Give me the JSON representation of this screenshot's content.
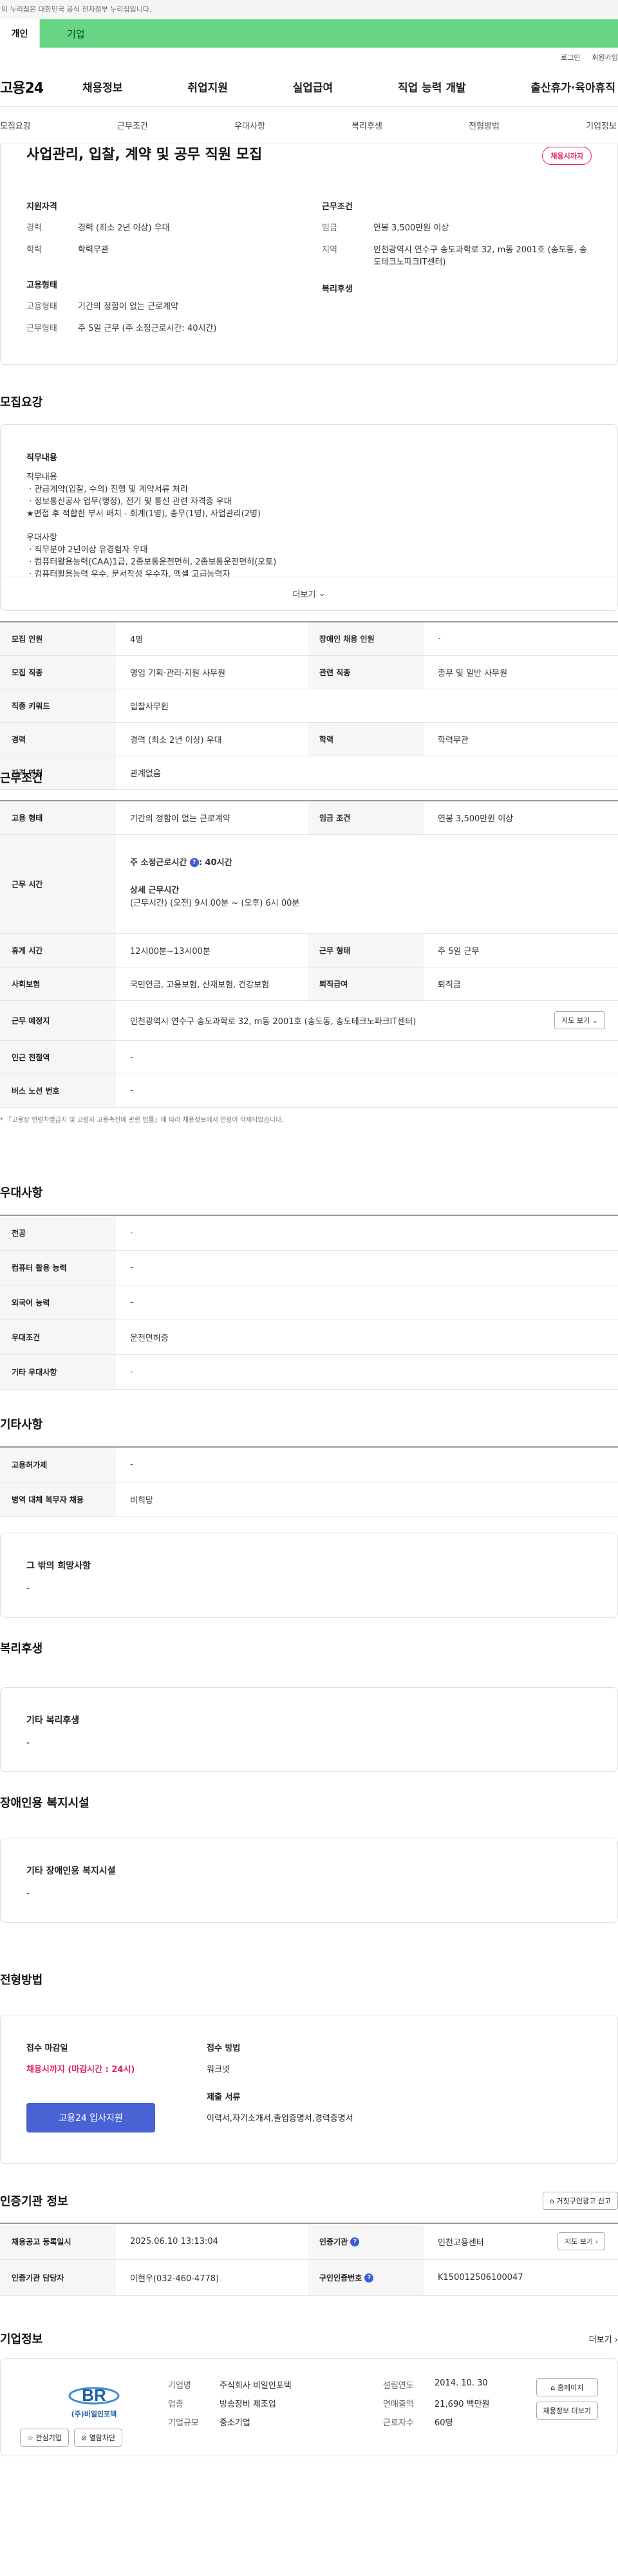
{
  "gov_banner": "이 누리집은 대한민국 공식 전자정부 누리집입니다.",
  "tabs": {
    "individual": "개인",
    "corporate": "기업"
  },
  "util": {
    "login": "로그인",
    "signup": "회원가입"
  },
  "logo": "고용24",
  "gnb": [
    "채용정보",
    "취업지원",
    "실업급여",
    "직업 능력 개발",
    "출산휴가·육아휴직"
  ],
  "subnav": [
    "모집요강",
    "근무조건",
    "우대사항",
    "복리후생",
    "전형방법",
    "기업정보"
  ],
  "summary": {
    "title": "사업관리, 입찰, 계약 및 공무 직원 모집",
    "badge": "채용시까지",
    "qual_h": "지원자격",
    "career_k": "경력",
    "career_v": "경력 (최소 2년 이상) 우대",
    "edu_k": "학력",
    "edu_v": "학력무관",
    "emp_h": "고용형태",
    "emptype_k": "고용형태",
    "emptype_v": "기간의 정함이 없는 근로계약",
    "workform_k": "근무형태",
    "workform_v": "주 5일 근무 (주 소정근로시간: 40시간)",
    "cond_h": "근무조건",
    "wage_k": "임금",
    "wage_v": "연봉 3,500만원 이상",
    "loc_k": "지역",
    "loc_v": "인천광역시 연수구 송도과학로 32, m동 2001호 (송도동, 송도테크노파크IT센터)",
    "welfare_h": "복리후생"
  },
  "recruit": {
    "title": "모집요강",
    "content_h": "직무내용",
    "content": "직무내용\n · 관급계약(입찰, 수의) 진행 및 계약서류 처리\n · 정보통신공사 업무(행정), 전기 및 통신 관련 자격증 우대\n★면접 후 적합한 부서 배치 - 회계(1명), 총무(1명), 사업관리(2명)\n\n우대사항\n · 직무분야 2년이상 유경험자 우대\n · 컴퓨터활용능력(CAA)1급, 2종보통운전면허, 2종보통운전면허(오토)\n · 컴퓨터활용능력 우수, 문서작성 우수자, 엑셀 고급능력자",
    "more": "더보기",
    "table": {
      "count_k": "모집 인원",
      "count_v": "4명",
      "disabled_k": "장애인 채용 인원",
      "disabled_v": "-",
      "job_k": "모집 직종",
      "job_v": "영업 기획·관리·지원 사무원",
      "rel_k": "관련 직종",
      "rel_v": "총무 및 일반 사무원",
      "kw_k": "직종 키워드",
      "kw_v": "입찰사무원",
      "career_k": "경력",
      "career_v": "경력 (최소 2년 이상) 우대",
      "edu_k": "학력",
      "edu_v": "학력무관",
      "license_k": "자격 면허",
      "license_v": "관계없음"
    }
  },
  "conditions": {
    "title": "근무조건",
    "emp_k": "고용 형태",
    "emp_v": "기간의 정함이 없는 근로계약",
    "wage_k": "임금 조건",
    "wage_v": "연봉 3,500만원 이상",
    "time_k": "근무 시간",
    "time_weekly": "주 소정근로시간",
    "time_weekly_v": ": 40시간",
    "time_detail_h": "상세 근무시간",
    "time_detail_v": "(근무시간) (오전) 9시 00분 ~ (오후) 6시 00분",
    "rest_k": "휴게 시간",
    "rest_v": "12시00분~13시00분",
    "form_k": "근무 형태",
    "form_v": "주 5일 근무",
    "ins_k": "사회보험",
    "ins_v": "국민연금, 고용보험, 산재보험, 건강보험",
    "sev_k": "퇴직급여",
    "sev_v": "퇴직금",
    "place_k": "근무 예정지",
    "place_v": "인천광역시 연수구 송도과학로 32, m동 2001호 (송도동, 송도테크노파크IT센터)",
    "map_btn": "지도 보기",
    "subway_k": "인근 전철역",
    "subway_v": "-",
    "bus_k": "버스 노선 번호",
    "bus_v": "-",
    "note": "* 『고용상 연령차별금지 및 고령자 고용촉진에 관한 법률』에 따라 채용정보에서 연령이 삭제되었습니다."
  },
  "prefer": {
    "title": "우대사항",
    "major_k": "전공",
    "major_v": "-",
    "pc_k": "컴퓨터 활용 능력",
    "pc_v": "-",
    "lang_k": "외국어 능력",
    "lang_v": "-",
    "cond_k": "우대조건",
    "cond_v": "운전면허증",
    "etc_k": "기타 우대사항",
    "etc_v": "-"
  },
  "other": {
    "title": "기타사항",
    "job_k": "고용허가제",
    "job_v": "-",
    "mil_k": "병역 대체 복무자 채용",
    "mil_v": "비희망",
    "wish_h": "그 밖의 희망사항",
    "wish_v": "-"
  },
  "welfare": {
    "title": "복리후생",
    "h": "기타 복리후생",
    "v": "-"
  },
  "disabled": {
    "title": "장애인용 복지시설",
    "h": "기타 장애인용 복지시설",
    "v": "-"
  },
  "apply": {
    "title": "전형방법",
    "deadline_h": "접수 마감일",
    "deadline_v": "채용시까지 (마감시간 : 24시)",
    "btn": "고용24 입사지원",
    "method_h": "접수 방법",
    "method_v": "워크넷",
    "docs_h": "제출 서류",
    "docs_v": "이력서,자기소개서,졸업증명서,경력증명서"
  },
  "cert": {
    "title": "인증기관 정보",
    "btn": "거짓구인광고 신고",
    "reg_k": "채용공고 등록일시",
    "reg_v": "2025.06.10 13:13:04",
    "org_k": "인증기관",
    "org_v": "인천고용센터",
    "map_btn": "지도 보기",
    "mgr_k": "인증기관 담당자",
    "mgr_v": "이현우(032-460-4778)",
    "num_k": "구인인증번호",
    "num_v": "K150012506100047"
  },
  "company": {
    "title": "기업정보",
    "more": "더보기",
    "logo_text": "(주)비일인포텍",
    "btn_interest": "관심기업",
    "btn_block": "열람차단",
    "name_k": "기업명",
    "name_v": "주식회사 비일인포텍",
    "ind_k": "업종",
    "ind_v": "방송장비 제조업",
    "size_k": "기업규모",
    "size_v": "중소기업",
    "est_k": "설립연도",
    "est_v": "2014. 10. 30",
    "sales_k": "연매출액",
    "sales_v": "21,690 백만원",
    "emp_k": "근로자수",
    "emp_v": "60명",
    "home_btn": "홈페이지",
    "jobs_btn": "채용정보 더보기"
  }
}
